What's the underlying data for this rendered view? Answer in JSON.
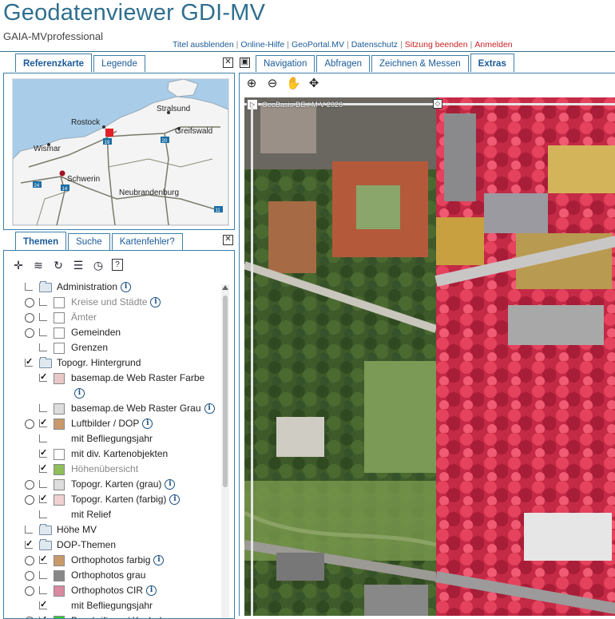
{
  "header": {
    "title": "Geodatenviewer GDI-MV",
    "subtitle": "GAIA-MVprofessional",
    "links": [
      {
        "label": "Titel ausblenden",
        "color": "#1a5a99"
      },
      {
        "label": "Online-Hilfe",
        "color": "#1a5a99"
      },
      {
        "label": "GeoPortal.MV",
        "color": "#1a5a99"
      },
      {
        "label": "Datenschutz",
        "color": "#1a5a99"
      },
      {
        "label": "Sitzung beenden",
        "color": "#cc2222"
      },
      {
        "label": "Anmelden",
        "color": "#cc2222"
      }
    ]
  },
  "left_top_tabs": [
    {
      "label": "Referenzkarte",
      "active": true
    },
    {
      "label": "Legende",
      "active": false
    }
  ],
  "minimap": {
    "cities": [
      "Stralsund",
      "Rostock",
      "Greifswald",
      "Wismar",
      "Schwerin",
      "Neubrandenburg"
    ],
    "road_numbers": [
      "19",
      "20",
      "24",
      "14",
      "11"
    ]
  },
  "left_bottom_tabs": [
    {
      "label": "Themen",
      "active": true
    },
    {
      "label": "Suche",
      "active": false
    },
    {
      "label": "Kartenfehler?",
      "active": false
    }
  ],
  "theme_tools": [
    "add-icon",
    "layers-icon",
    "refresh-icon",
    "layers-stack-icon",
    "clock-icon",
    "help-icon"
  ],
  "tree": [
    {
      "label": "Administration",
      "indent": 0,
      "type": "folder",
      "radio": false,
      "checked": false,
      "info": true,
      "grey": false
    },
    {
      "label": "Kreise und Städte",
      "indent": 1,
      "type": "layer",
      "radio": true,
      "checked": false,
      "info": true,
      "grey": true,
      "thumb": "#fff"
    },
    {
      "label": "Ämter",
      "indent": 1,
      "type": "layer",
      "radio": true,
      "checked": false,
      "info": false,
      "grey": true,
      "thumb": "#fff"
    },
    {
      "label": "Gemeinden",
      "indent": 1,
      "type": "layer",
      "radio": true,
      "checked": false,
      "info": false,
      "grey": false,
      "thumb": "#fff"
    },
    {
      "label": "Grenzen",
      "indent": 1,
      "type": "layer",
      "radio": false,
      "checked": false,
      "info": false,
      "grey": false,
      "thumb": "#fff"
    },
    {
      "label": "Topogr. Hintergrund",
      "indent": 0,
      "type": "folder",
      "radio": false,
      "checked": true,
      "info": false,
      "grey": false
    },
    {
      "label": "basemap.de Web Raster Farbe",
      "indent": 1,
      "type": "layer",
      "radio": false,
      "checked": true,
      "info": false,
      "grey": false,
      "thumb": "#e8c8c8"
    },
    {
      "label": "",
      "indent": 1,
      "type": "infoonly",
      "radio": false,
      "checked": false,
      "info": true,
      "grey": false
    },
    {
      "label": "basemap.de Web Raster Grau",
      "indent": 1,
      "type": "layer",
      "radio": false,
      "checked": false,
      "info": true,
      "grey": false,
      "thumb": "#ddd"
    },
    {
      "label": "Luftbilder / DOP",
      "indent": 1,
      "type": "layer",
      "radio": true,
      "checked": true,
      "info": true,
      "grey": false,
      "thumb": "#c89a6a"
    },
    {
      "label": "mit Befliegungsjahr",
      "indent": 1,
      "type": "layer",
      "radio": false,
      "checked": false,
      "info": false,
      "grey": false,
      "nothumb": true
    },
    {
      "label": "mit div. Kartenobjekten",
      "indent": 1,
      "type": "layer",
      "radio": false,
      "checked": true,
      "info": false,
      "grey": false,
      "thumb": "#fff"
    },
    {
      "label": "Höhenübersicht",
      "indent": 1,
      "type": "layer",
      "radio": false,
      "checked": true,
      "info": false,
      "grey": true,
      "thumb": "#8fbf5a"
    },
    {
      "label": "Topogr. Karten (grau)",
      "indent": 1,
      "type": "layer",
      "radio": true,
      "checked": false,
      "info": true,
      "grey": false,
      "thumb": "#ddd"
    },
    {
      "label": "Topogr. Karten (farbig)",
      "indent": 1,
      "type": "layer",
      "radio": true,
      "checked": true,
      "info": true,
      "grey": false,
      "thumb": "#f0d0d0"
    },
    {
      "label": "mit Relief",
      "indent": 1,
      "type": "layer",
      "radio": false,
      "checked": false,
      "info": false,
      "grey": false,
      "nothumb": true
    },
    {
      "label": "Höhe MV",
      "indent": 0,
      "type": "folder",
      "radio": false,
      "checked": false,
      "info": false,
      "grey": false
    },
    {
      "label": "DOP-Themen",
      "indent": 0,
      "type": "folder",
      "radio": false,
      "checked": true,
      "info": false,
      "grey": false
    },
    {
      "label": "Orthophotos farbig",
      "indent": 1,
      "type": "layer",
      "radio": true,
      "checked": true,
      "info": true,
      "grey": false,
      "thumb": "#c89a6a"
    },
    {
      "label": "Orthophotos grau",
      "indent": 1,
      "type": "layer",
      "radio": true,
      "checked": false,
      "info": false,
      "grey": false,
      "thumb": "#888"
    },
    {
      "label": "Orthophotos CIR",
      "indent": 1,
      "type": "layer",
      "radio": true,
      "checked": false,
      "info": true,
      "grey": false,
      "thumb": "#d88aa0"
    },
    {
      "label": "mit Befliegungsjahr",
      "indent": 1,
      "type": "layer",
      "radio": false,
      "checked": true,
      "info": false,
      "grey": false,
      "nothumb": true
    },
    {
      "label": "Beschriftung / Kacheln",
      "indent": 1,
      "type": "layer",
      "radio": true,
      "checked": true,
      "info": false,
      "grey": false,
      "thumb": "#3c3"
    }
  ],
  "map_tabs": [
    {
      "label": "Navigation",
      "active": false
    },
    {
      "label": "Abfragen",
      "active": false
    },
    {
      "label": "Zeichnen & Messen",
      "active": false
    },
    {
      "label": "Extras",
      "active": true
    }
  ],
  "map_tools": [
    "zoom-in-icon",
    "zoom-out-icon",
    "pan-hand-icon",
    "move-icon"
  ],
  "map": {
    "copyright": "GeoBasis-DE / M-V 2026",
    "swipe_fraction": 0.515
  }
}
